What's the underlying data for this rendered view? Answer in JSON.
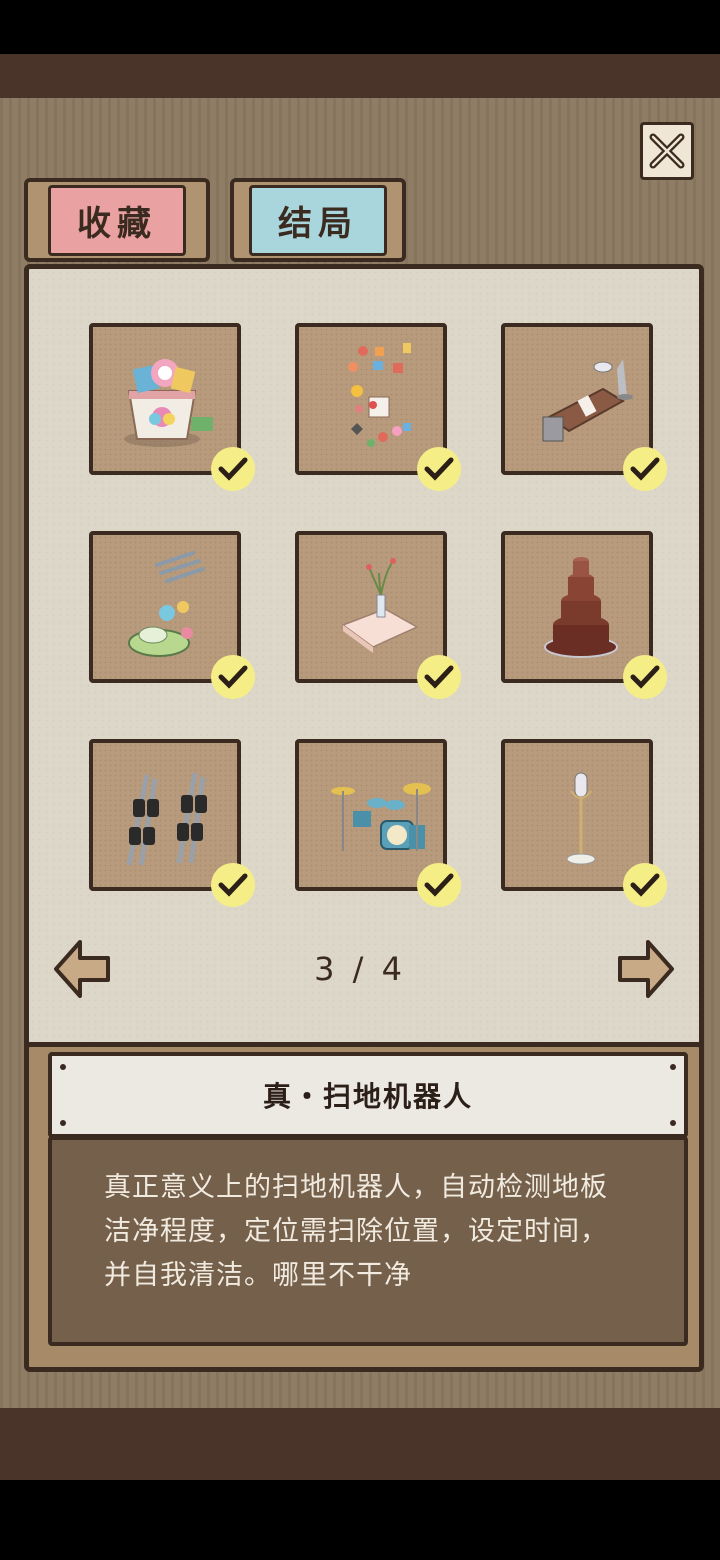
{
  "tabs": [
    {
      "label": "收藏",
      "color": "#e9a1a1"
    },
    {
      "label": "结局",
      "color": "#a9d6dc"
    }
  ],
  "pagination": {
    "current": 3,
    "total": 4,
    "text": "3 / 4"
  },
  "items": [
    {
      "icon": "candy-bucket-icon",
      "collected": true
    },
    {
      "icon": "fridge-magnets-icon",
      "collected": true
    },
    {
      "icon": "office-tray-icon",
      "collected": true
    },
    {
      "icon": "tableware-icon",
      "collected": true
    },
    {
      "icon": "vase-table-icon",
      "collected": true
    },
    {
      "icon": "chocolate-fountain-icon",
      "collected": true
    },
    {
      "icon": "dumbbell-rack-icon",
      "collected": true
    },
    {
      "icon": "drum-kit-icon",
      "collected": true
    },
    {
      "icon": "microphone-stand-icon",
      "collected": true
    }
  ],
  "detail": {
    "title": "真・扫地机器人",
    "description": "真正意义上的扫地机器人，自动检测地板洁净程度，定位需扫除位置，设定时间，并自我清洁。哪里不干净"
  },
  "colors": {
    "frame": "#3a2a20",
    "panel": "#ddd7ca",
    "slot": "#b89b7c",
    "check": "#f5ee87"
  }
}
